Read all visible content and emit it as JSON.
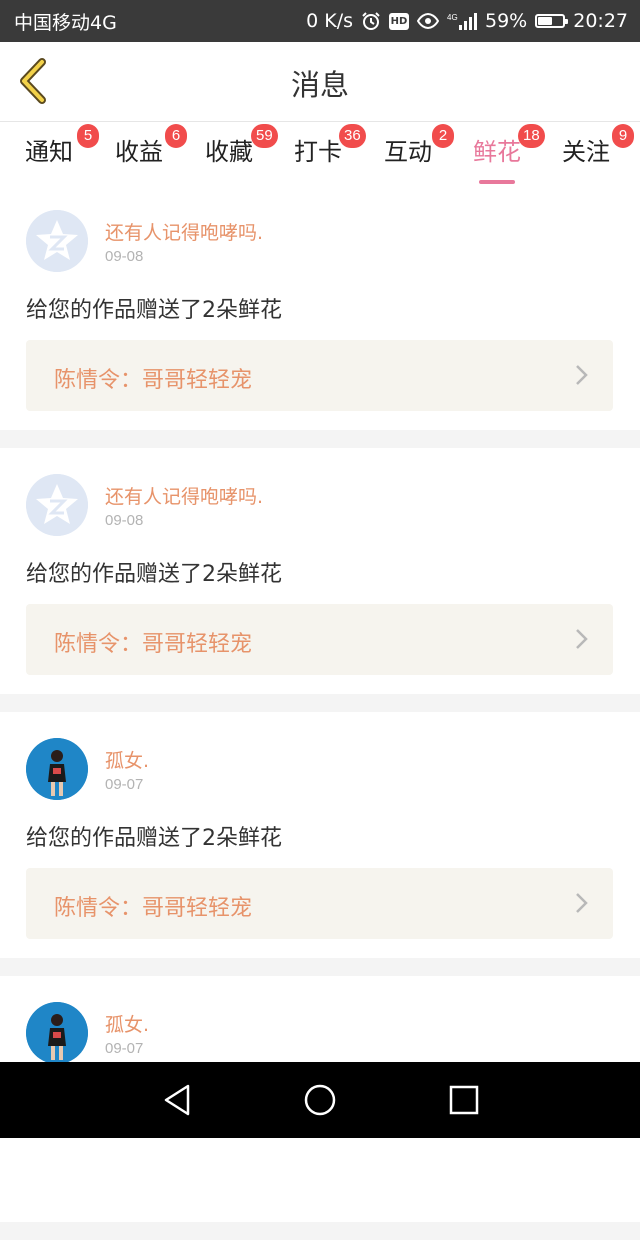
{
  "status_bar": {
    "carrier": "中国移动4G",
    "net_speed": "0 K/s",
    "hd": "HD",
    "battery": "59%",
    "battery_level": 0.59,
    "time": "20:27"
  },
  "header": {
    "title": "消息"
  },
  "tabs": [
    {
      "label": "通知",
      "badge": "5"
    },
    {
      "label": "收益",
      "badge": "6"
    },
    {
      "label": "收藏",
      "badge": "59"
    },
    {
      "label": "打卡",
      "badge": "36"
    },
    {
      "label": "互动",
      "badge": "2"
    },
    {
      "label": "鲜花",
      "badge": "18",
      "active": true
    },
    {
      "label": "关注",
      "badge": "9"
    }
  ],
  "colors": {
    "accent": "#e8789b",
    "badge": "#f14c4c",
    "name": "#e7936a"
  },
  "feed": [
    {
      "name": "还有人记得咆哮吗.",
      "date": "09-08",
      "message": "给您的作品赠送了2朵鲜花",
      "ref": "陈情令：哥哥轻轻宠",
      "avatar": "default-avatar"
    },
    {
      "name": "还有人记得咆哮吗.",
      "date": "09-08",
      "message": "给您的作品赠送了2朵鲜花",
      "ref": "陈情令：哥哥轻轻宠",
      "avatar": "default-avatar"
    },
    {
      "name": "孤女.",
      "date": "09-07",
      "message": "给您的作品赠送了2朵鲜花",
      "ref": "陈情令：哥哥轻轻宠",
      "avatar": "photo-avatar"
    },
    {
      "name": "孤女.",
      "date": "09-07",
      "message": "",
      "ref": "",
      "avatar": "photo-avatar"
    }
  ]
}
